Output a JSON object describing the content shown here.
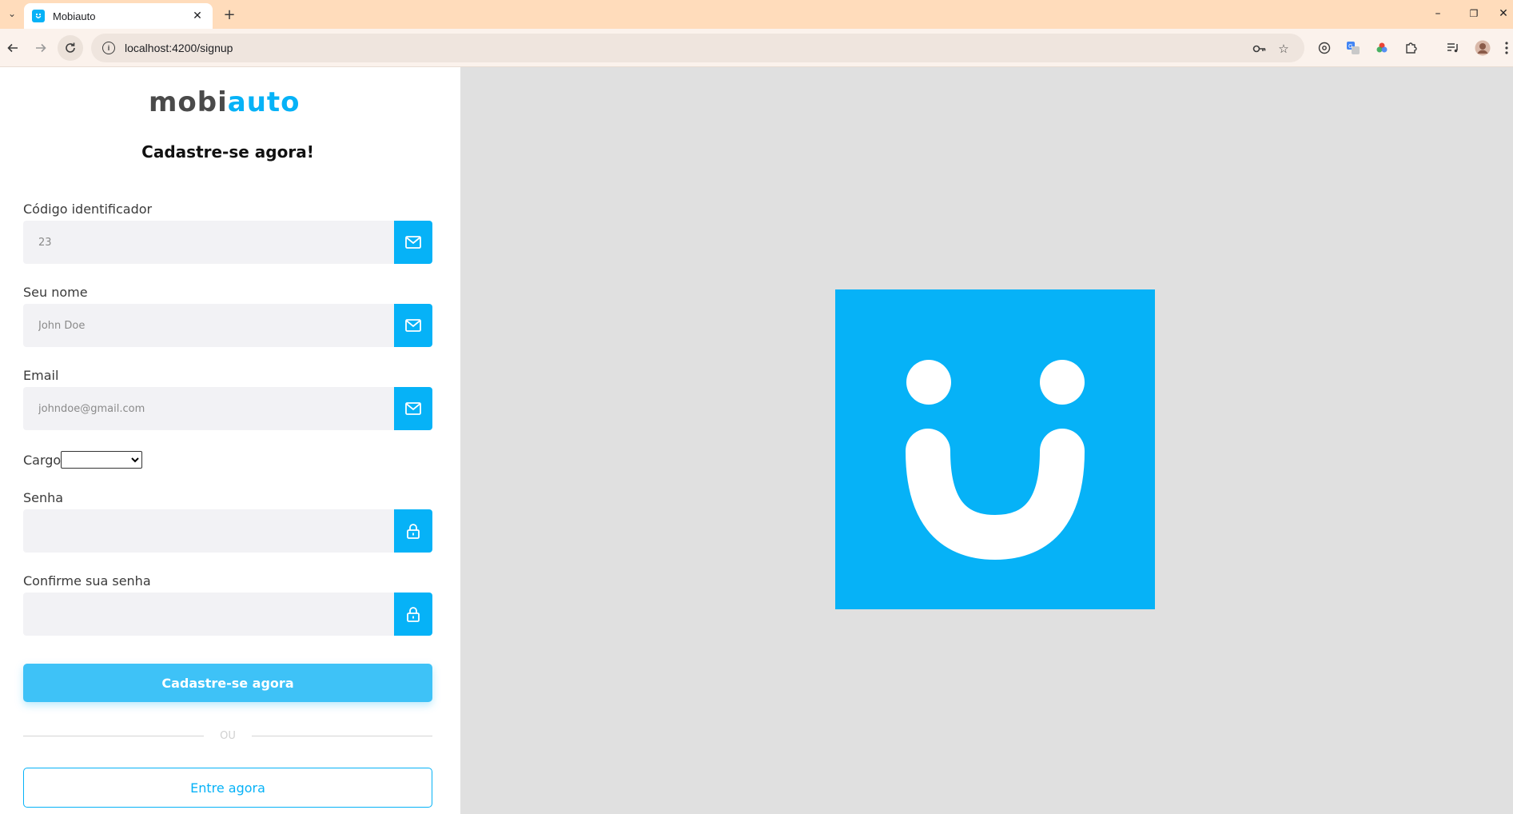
{
  "browser": {
    "tab_title": "Mobiauto",
    "tab_close": "✕",
    "new_tab": "+",
    "url": "localhost:4200/signup",
    "window_controls": {
      "minimize": "–",
      "restore": "❐",
      "close": "✕"
    }
  },
  "logo": {
    "part1": "mobi",
    "part2": "auto"
  },
  "heading": "Cadastre-se agora!",
  "form": {
    "code": {
      "label": "Código identificador",
      "placeholder": "23",
      "icon": "mail-icon"
    },
    "name": {
      "label": "Seu nome",
      "placeholder": "John Doe",
      "icon": "mail-icon"
    },
    "email": {
      "label": "Email",
      "placeholder": "johndoe@gmail.com",
      "icon": "mail-icon"
    },
    "cargo": {
      "label": "Cargo",
      "selected": ""
    },
    "password": {
      "label": "Senha",
      "placeholder": "",
      "icon": "lock-icon"
    },
    "confirm_password": {
      "label": "Confirme sua senha",
      "placeholder": "",
      "icon": "lock-icon"
    }
  },
  "submit_label": "Cadastre-se agora",
  "divider_text": "OU",
  "login_label": "Entre agora",
  "colors": {
    "brand": "#06b2f7",
    "button": "#3ec2f7",
    "panel_bg": "#e0e0e0"
  }
}
